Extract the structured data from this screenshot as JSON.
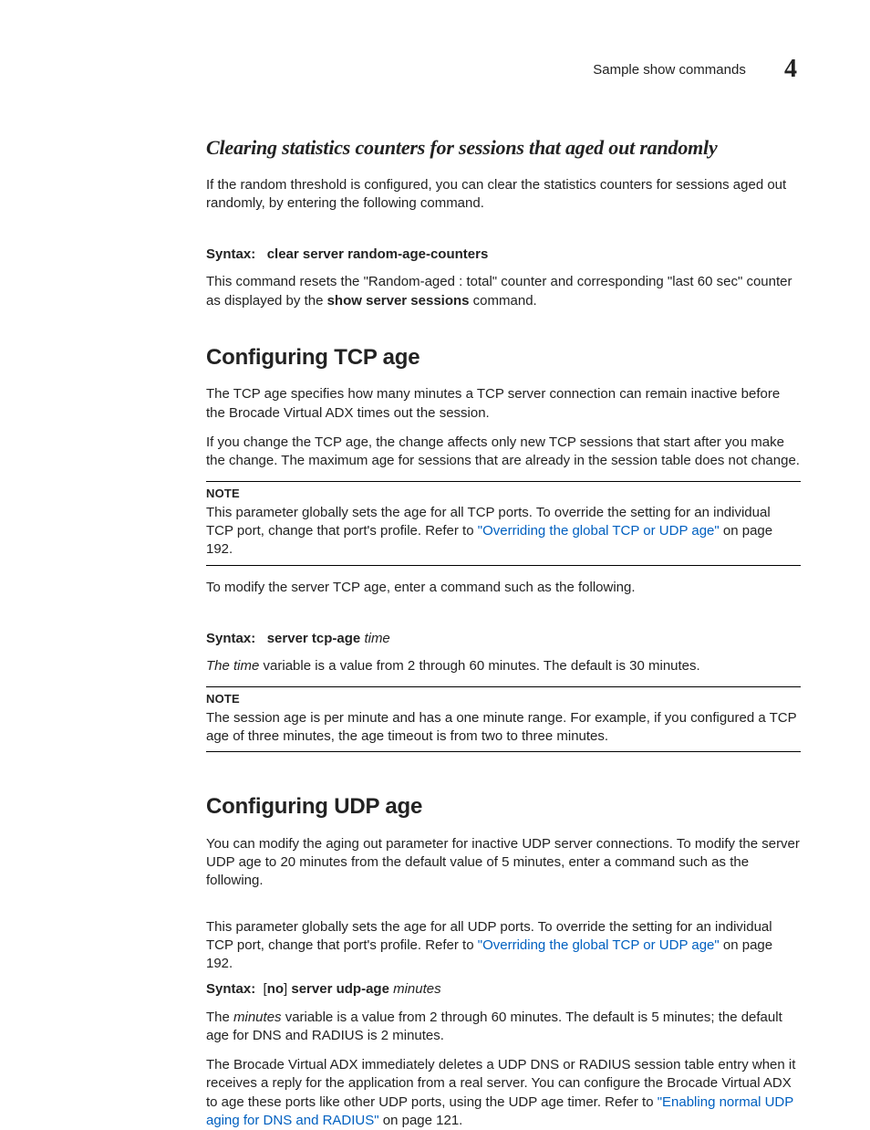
{
  "header": {
    "title": "Sample show commands",
    "chapter_number": "4"
  },
  "sec1": {
    "heading": "Clearing statistics counters for sessions that aged out randomly",
    "intro": "If the random threshold is configured, you can clear the statistics counters for sessions aged out randomly, by entering the following command.",
    "syntax_label": "Syntax:",
    "syntax_cmd": "clear server random-age-counters",
    "desc_pre": "This command resets the \"Random-aged : total\" counter and corresponding \"last 60 sec\" counter as displayed by the ",
    "desc_bold": "show server sessions",
    "desc_post": " command."
  },
  "sec2": {
    "heading": "Configuring TCP age",
    "p1": "The TCP age specifies how many minutes a TCP server connection can remain inactive before the Brocade Virtual ADX times out the session.",
    "p2": "If you change the TCP age, the change affects only new TCP sessions that start after you make the change. The maximum age for sessions that are already in the session table does not change.",
    "note1_label": "NOTE",
    "note1_pre": "This parameter globally sets the age for all TCP ports. To override the setting for an individual TCP port, change that port's profile. Refer to ",
    "note1_link": "\"Overriding the global TCP or UDP age\"",
    "note1_post": " on page 192.",
    "p3": "To modify the server TCP age, enter a command such as the following.",
    "syntax_label": "Syntax:",
    "syntax_cmd": "server tcp-age",
    "syntax_arg": "time",
    "p4_pre": "The time",
    "p4_post": " variable is a value from 2 through 60 minutes. The default is 30 minutes.",
    "note2_label": "NOTE",
    "note2_body": "The session age is per minute and has a one minute range. For example, if you configured a TCP age of three minutes, the age timeout is from two to three minutes."
  },
  "sec3": {
    "heading": "Configuring UDP age",
    "p1": "You can modify the aging out parameter for inactive UDP server connections. To modify the server UDP age to 20 minutes from the default value of 5 minutes, enter a command such as the following.",
    "p2_pre": "This parameter globally sets the age for all UDP ports. To override the setting for an individual TCP port, change that port's profile. Refer to ",
    "p2_link": "\"Overriding the global TCP or UDP age\"",
    "p2_post": " on page 192.",
    "syntax_label": "Syntax:",
    "syntax_no": "no",
    "syntax_cmd": "server udp-age",
    "syntax_arg": "minutes",
    "p3_pre": "The ",
    "p3_ital": "minutes",
    "p3_post": " variable is a value from 2 through 60 minutes. The default is 5 minutes; the default age for DNS and RADIUS is 2 minutes.",
    "p4_pre": "The Brocade Virtual ADX immediately deletes a UDP DNS or RADIUS session table entry when it receives a reply for the application from a real server. You can configure the Brocade Virtual ADX to age these ports like other UDP ports, using the UDP age timer. Refer to ",
    "p4_link": "\"Enabling normal UDP aging for DNS and RADIUS\"",
    "p4_post": " on page 121."
  }
}
